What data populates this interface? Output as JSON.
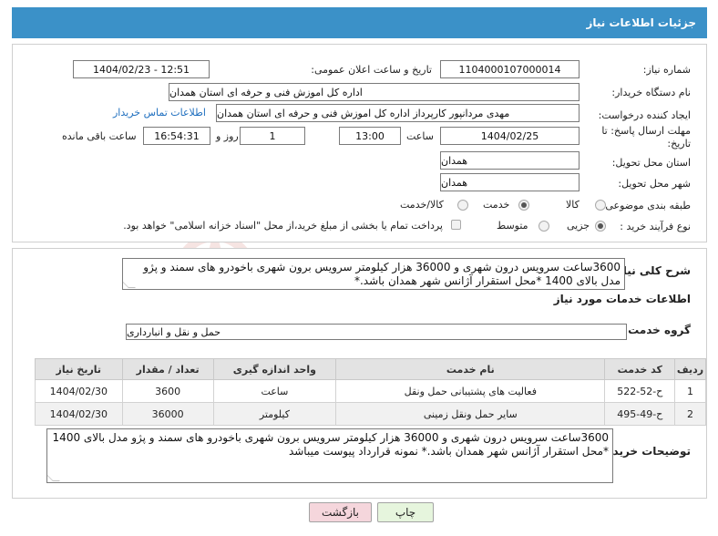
{
  "header": {
    "title": "جزئیات اطلاعات نیاز"
  },
  "need_number": {
    "label": "شماره نیاز:",
    "value": "1104000107000014"
  },
  "announce": {
    "label": "تاریخ و ساعت اعلان عمومی:",
    "value": "1404/02/23 - 12:51"
  },
  "buyer_org": {
    "label": "نام دستگاه خریدار:",
    "value": "اداره کل اموزش فنی و حرفه ای استان همدان"
  },
  "creator": {
    "label": "ایجاد کننده درخواست:",
    "value": "مهدی مردانپور کارپرداز اداره کل اموزش فنی و حرفه ای استان همدان",
    "contact_link": "اطلاعات تماس خریدار"
  },
  "deadline": {
    "label_line1": "مهلت ارسال پاسخ: تا",
    "label_line2": "تاریخ:",
    "date": "1404/02/25",
    "time_label": "ساعت",
    "time": "13:00",
    "days": "1",
    "days_label": "روز و",
    "remaining": "16:54:31",
    "remaining_label": "ساعت باقی مانده"
  },
  "delivery_province": {
    "label": "استان محل تحویل:",
    "value": "همدان"
  },
  "delivery_city": {
    "label": "شهر محل تحویل:",
    "value": "همدان"
  },
  "category": {
    "label": "طبقه بندی موضوعی:",
    "options": [
      {
        "label": "کالا",
        "selected": false
      },
      {
        "label": "خدمت",
        "selected": true
      },
      {
        "label": "کالا/خدمت",
        "selected": false
      }
    ]
  },
  "purchase_type": {
    "label": "نوع فرآیند خرید :",
    "options": [
      {
        "label": "جزیی",
        "selected": true
      },
      {
        "label": "متوسط",
        "selected": false
      }
    ],
    "payment_note": "پرداخت تمام یا بخشی از مبلغ خرید،از محل \"اسناد خزانه اسلامی\" خواهد بود."
  },
  "summary": {
    "label": "شرح کلی نیاز:",
    "text": "3600ساعت سرویس درون شهری و 36000 هزار کیلومتر سرویس برون شهری باخودرو های سمند و پژو مدل بالای 1400 *محل استقرار آژانس شهر همدان باشد.*"
  },
  "services_title": "اطلاعات خدمات مورد نیاز",
  "service_group": {
    "label": "گروه خدمت:",
    "value": "حمل و نقل و انبارداری"
  },
  "table": {
    "headers": [
      "ردیف",
      "کد خدمت",
      "نام خدمت",
      "واحد اندازه گیری",
      "تعداد / مقدار",
      "تاریخ نیاز"
    ],
    "rows": [
      [
        "1",
        "ح-52-522",
        "فعالیت های پشتیبانی حمل ونقل",
        "ساعت",
        "3600",
        "1404/02/30"
      ],
      [
        "2",
        "ح-49-495",
        "سایر حمل ونقل زمینی",
        "کیلومتر",
        "36000",
        "1404/02/30"
      ]
    ]
  },
  "buyer_notes": {
    "label": "توضیحات خریدار:",
    "text": "3600ساعت سرویس درون شهری و 36000 هزار کیلومتر سرویس برون شهری باخودرو های سمند و پژو مدل بالای 1400 *محل استقرار آژانس شهر همدان باشد.* نمونه قرارداد پیوست میباشد"
  },
  "buttons": {
    "back": "بازگشت",
    "print": "چاپ"
  },
  "watermark": {
    "text": "AriaTender.neT"
  },
  "colors": {
    "header_bg": "#3b91c8",
    "link": "#1f6fbf",
    "back_btn_bg": "#f5d6dc",
    "print_btn_bg": "#e6f5dd"
  }
}
